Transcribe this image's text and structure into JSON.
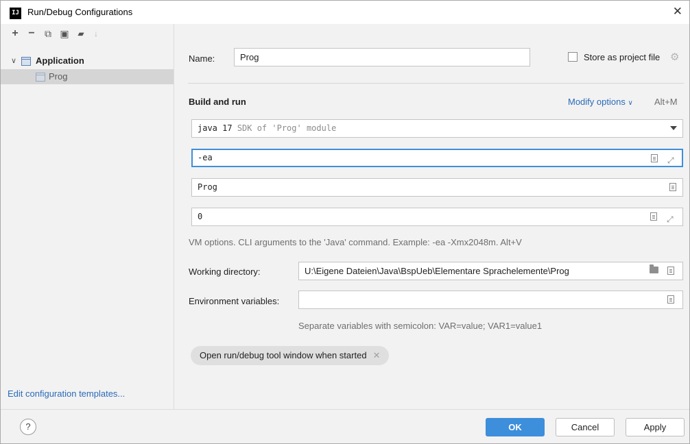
{
  "window": {
    "title": "Run/Debug Configurations",
    "app_logo": "IJ",
    "close_glyph": "✕"
  },
  "toolbar": {
    "add": "+",
    "remove": "−",
    "copy": "⧉",
    "save": "▣",
    "folder": "▰",
    "sort": "↓"
  },
  "tree": {
    "group": {
      "label": "Application",
      "chevron": "∨"
    },
    "items": [
      {
        "label": "Prog"
      }
    ]
  },
  "left_footer": {
    "edit_templates": "Edit configuration templates..."
  },
  "form": {
    "name_label": "Name:",
    "name_value": "Prog",
    "store_label": "Store as project file",
    "section_title": "Build and run",
    "modify_options": "Modify options",
    "modify_chevron": "∨",
    "modify_shortcut": "Alt+M",
    "jre_value": "java 17",
    "jre_hint": "SDK of 'Prog' module",
    "vm_options": "-ea",
    "main_class": "Prog",
    "program_args": "0",
    "vm_hint": "VM options. CLI arguments to the 'Java' command. Example: -ea -Xmx2048m. Alt+V",
    "workdir_label": "Working directory:",
    "workdir_value": "U:\\Eigene Dateien\\Java\\BspUeb\\Elementare Sprachelemente\\Prog",
    "env_label": "Environment variables:",
    "env_value": "",
    "env_hint": "Separate variables with semicolon: VAR=value; VAR1=value1",
    "chip_label": "Open run/debug tool window when started",
    "chip_close": "✕"
  },
  "footer": {
    "help": "?",
    "ok": "OK",
    "cancel": "Cancel",
    "apply": "Apply"
  },
  "colors": {
    "accent": "#3d8edb",
    "link": "#2a6ab8",
    "background": "#f2f2f2"
  }
}
